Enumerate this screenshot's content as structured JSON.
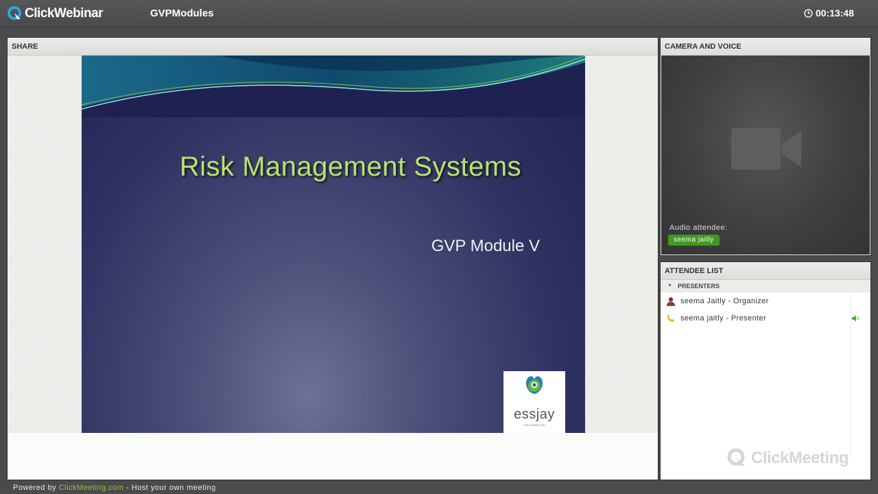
{
  "app": {
    "brand": "ClickWebinar",
    "meeting_title": "GVPModules",
    "timer": "00:13:48"
  },
  "share": {
    "header": "SHARE",
    "slide": {
      "title": "Risk Management Systems",
      "subtitle": "GVP Module V",
      "logo_text": "essjay",
      "logo_tagline": "SOLUTIONS LTD"
    }
  },
  "camera": {
    "header": "CAMERA AND VOICE",
    "audio_label": "Audio attendee:",
    "audio_attendee": "seema jaitly"
  },
  "attendees": {
    "header": "ATTENDEE LIST",
    "group_label": "PRESENTERS",
    "rows": [
      {
        "label": "seema Jaitly - Organizer",
        "icon": "user-icon"
      },
      {
        "label": "seema jaitly - Presenter",
        "icon": "phone-icon",
        "speaker": true
      }
    ],
    "watermark": "ClickMeeting"
  },
  "footer": {
    "prefix": "Powered by ",
    "link": "ClickMeeting.com",
    "suffix": " - Host your own meeting"
  },
  "colors": {
    "accent_green": "#8cc63f",
    "title_green": "#b8e36e",
    "badge_green": "#3f9a1e",
    "brand_blue": "#29a8e0"
  }
}
